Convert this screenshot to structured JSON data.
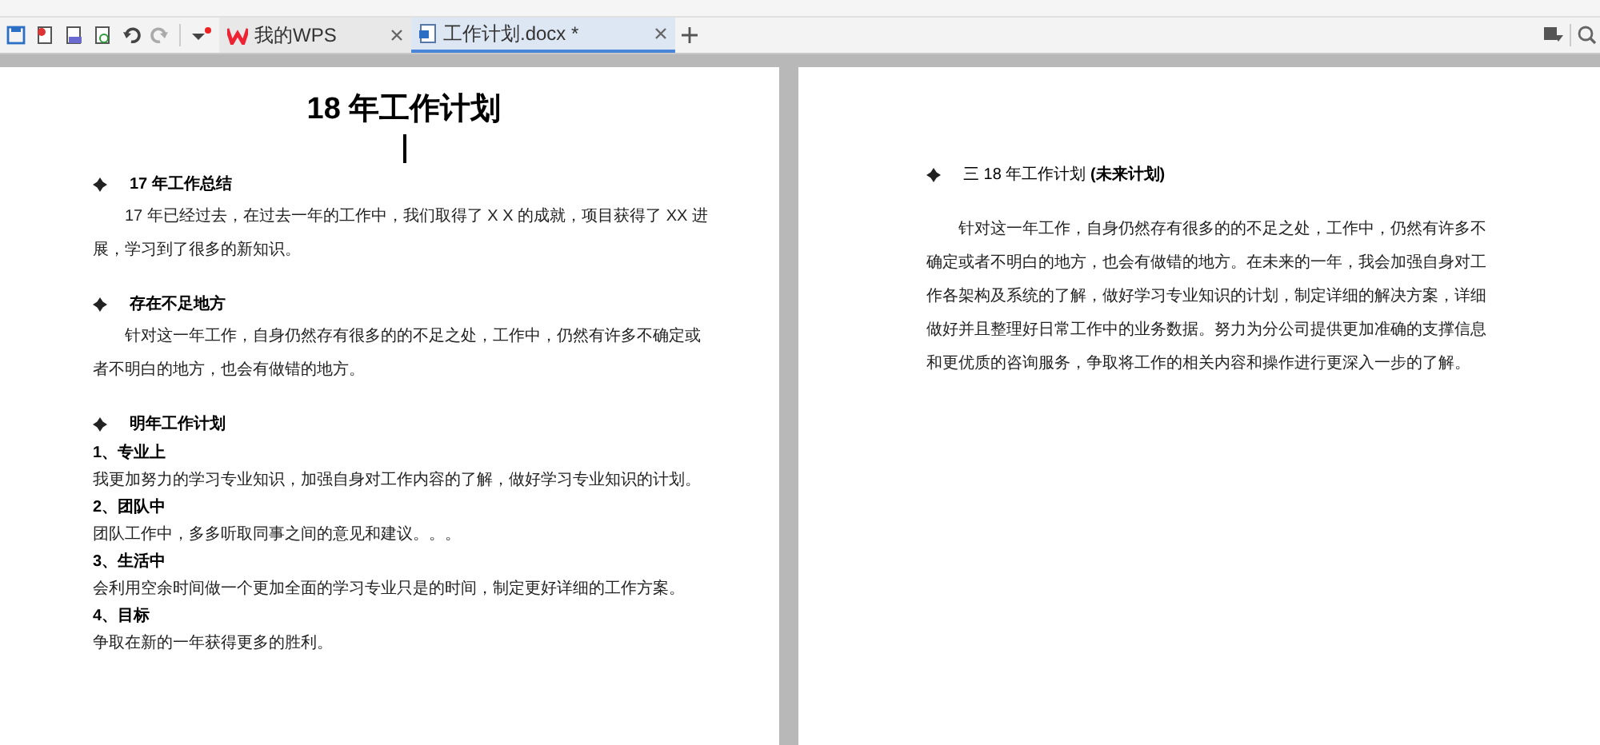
{
  "tabs": [
    {
      "label": "我的WPS",
      "kind": "home",
      "selected": false
    },
    {
      "label": "工作计划.docx *",
      "kind": "doc",
      "selected": true
    }
  ],
  "pages": [
    {
      "blocks": [
        {
          "kind": "title",
          "text": "18 年工作计划"
        },
        {
          "kind": "cursor"
        },
        {
          "kind": "bullet",
          "text": "17 年工作总结"
        },
        {
          "kind": "indent",
          "text": "17 年已经过去，在过去一年的工作中，我们取得了 X X 的成就，项目获得了 XX 进展，学习到了很多的新知识。"
        },
        {
          "kind": "gap"
        },
        {
          "kind": "bullet",
          "text": "存在不足地方"
        },
        {
          "kind": "indent",
          "text": "针对这一年工作，自身仍然存有很多的的不足之处，工作中，仍然有许多不确定或者不明白的地方，也会有做错的地方。"
        },
        {
          "kind": "gap"
        },
        {
          "kind": "bullet",
          "text": "明年工作计划"
        },
        {
          "kind": "numbered",
          "text": "1、专业上"
        },
        {
          "kind": "plain",
          "text": "我更加努力的学习专业知识，加强自身对工作内容的了解，做好学习专业知识的计划。"
        },
        {
          "kind": "numbered",
          "text": "2、团队中"
        },
        {
          "kind": "plain",
          "text": "团队工作中，多多听取同事之间的意见和建议。。。"
        },
        {
          "kind": "numbered",
          "text": "3、生活中"
        },
        {
          "kind": "plain",
          "text": "会利用空余时间做一个更加全面的学习专业只是的时间，制定更好详细的工作方案。"
        },
        {
          "kind": "numbered",
          "text": "4、目标"
        },
        {
          "kind": "plain",
          "text": "争取在新的一年获得更多的胜利。"
        }
      ]
    },
    {
      "blocks": [
        {
          "kind": "bullet_rich",
          "text": "三 18 年工作计划 **(未来计划)**"
        },
        {
          "kind": "gap"
        },
        {
          "kind": "indent",
          "text": "针对这一年工作，自身仍然存有很多的的不足之处，工作中，仍然有许多不确定或者不明白的地方，也会有做错的地方。在未来的一年，我会加强自身对工作各架构及系统的了解，做好学习专业知识的计划，制定详细的解决方案，详细做好并且整理好日常工作中的业务数据。努力为分公司提供更加准确的支撑信息和更优质的咨询服务，争取将工作的相关内容和操作进行更深入一步的了解。"
        }
      ]
    }
  ]
}
